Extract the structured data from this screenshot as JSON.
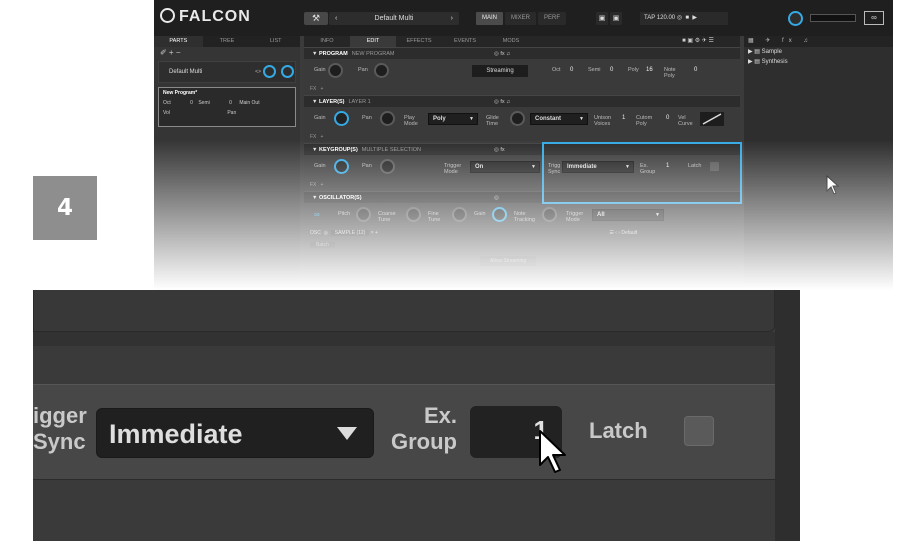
{
  "step_number": "4",
  "topbar": {
    "logo": "FALCON",
    "program_name": "Default Multi",
    "views": [
      "MAIN",
      "MIXER",
      "PERF"
    ],
    "tap_label": "TAP",
    "tempo": "120.00"
  },
  "left_panel": {
    "tabs": [
      "PARTS",
      "TREE",
      "LIST"
    ],
    "multi_name": "Default Multi",
    "program_name": "New Program*",
    "row1": [
      "Oct",
      "0",
      "Semi",
      "0",
      "Main Out"
    ],
    "row2": [
      "Vol",
      "Pan"
    ]
  },
  "center": {
    "tabs": [
      "INFO",
      "EDIT",
      "EFFECTS",
      "EVENTS",
      "MODS"
    ],
    "program": {
      "title": "PROGRAM",
      "sub": "NEW PROGRAM",
      "gain": "Gain",
      "pan": "Pan",
      "streaming": "Streaming",
      "oct": "Oct",
      "oct_val": "0",
      "semi": "Semi",
      "semi_val": "0",
      "poly": "Poly",
      "poly_val": "16",
      "note_poly": "Note Poly",
      "note_poly_val": "0"
    },
    "layer": {
      "title": "LAYER(S)",
      "sub": "LAYER 1",
      "gain": "Gain",
      "pan": "Pan",
      "play_mode": "Play Mode",
      "play_mode_val": "Poly",
      "glide": "Glide Time",
      "glide_mode": "Constant",
      "unison": "Unison Voices",
      "unison_val": "1",
      "cutom": "Cutom Poly",
      "cutom_val": "0",
      "vel": "Vel Curve"
    },
    "keygroup": {
      "title": "KEYGROUP(S)",
      "sub": "MULTIPLE SELECTION",
      "gain": "Gain",
      "pan": "Pan",
      "trigger_mode": "Trigger Mode",
      "trigger_mode_val": "On",
      "trigger_sync": "Trigger Sync",
      "trigger_sync_val": "Immediate",
      "ex_group": "Ex. Group",
      "ex_group_val": "1",
      "latch": "Latch"
    },
    "oscillator": {
      "title": "OSCILLATOR(S)",
      "pitch": "Pitch",
      "coarse": "Coarse Tune",
      "fine": "Fine Tune",
      "gain": "Gain",
      "note_tracking": "Note Tracking",
      "trigger_mode": "Trigger Mode",
      "trigger_mode_val": "All",
      "osc": "OSC",
      "sample": "SAMPLE (12)",
      "default": "Default",
      "batch": "Batch",
      "allow_streaming": "Allow Streaming"
    },
    "fx": "FX"
  },
  "right_panel": {
    "items": [
      "Sample",
      "Synthesis"
    ]
  },
  "zoom": {
    "trigger_label_1": "igger",
    "trigger_label_2": "Sync",
    "select_value": "Immediate",
    "ex_label_1": "Ex.",
    "ex_label_2": "Group",
    "ex_value": "1",
    "latch_label": "Latch"
  }
}
